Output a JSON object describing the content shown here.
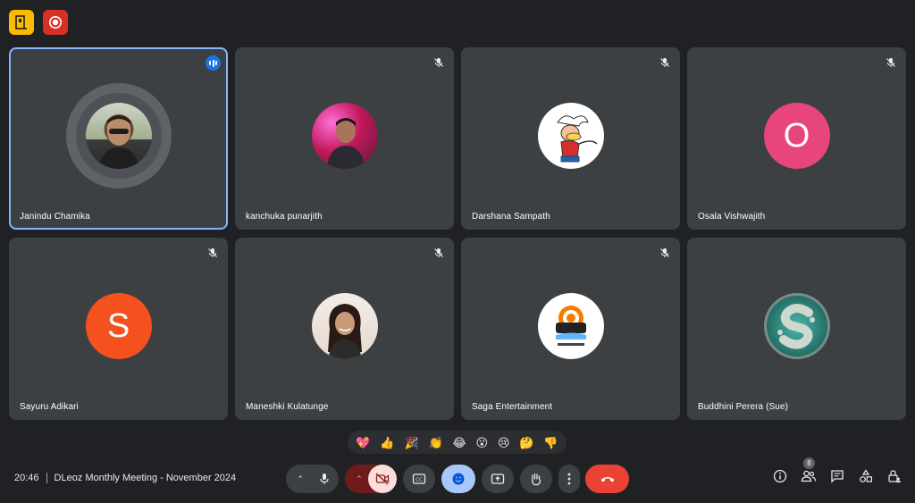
{
  "meeting": {
    "time": "20:46",
    "title": "DLeoz Monthly Meeting - November 2024"
  },
  "participants": [
    {
      "name": "Janindu Chamika",
      "avatar": "photo",
      "speaking": true,
      "muted": false
    },
    {
      "name": "kanchuka punarjith",
      "avatar": "photo",
      "muted": true
    },
    {
      "name": "Darshana Sampath",
      "avatar": "cartoon-photo",
      "muted": true
    },
    {
      "name": "Osala Vishwajith",
      "avatar": "letter",
      "letter": "O",
      "color": "#e8457c",
      "muted": true
    },
    {
      "name": "Sayuru Adikari",
      "avatar": "letter",
      "letter": "S",
      "color": "#f4511e",
      "muted": true
    },
    {
      "name": "Maneshki Kulatunge",
      "avatar": "photo",
      "muted": true
    },
    {
      "name": "Saga Entertainment",
      "avatar": "logo",
      "muted": true
    },
    {
      "name": "Buddhini Perera (Sue)",
      "avatar": "logo-s",
      "letter": "S",
      "muted": false
    }
  ],
  "reactions": [
    "💖",
    "👍",
    "🎉",
    "👏",
    "😂",
    "😮",
    "😢",
    "🤔",
    "👎"
  ],
  "people_count": "8",
  "colors": {
    "background": "#202124",
    "tile": "#3c4043",
    "accent": "#8ab4f8",
    "end_call": "#ea4335",
    "host_controls": "#f9bc02",
    "record": "#d93025"
  }
}
